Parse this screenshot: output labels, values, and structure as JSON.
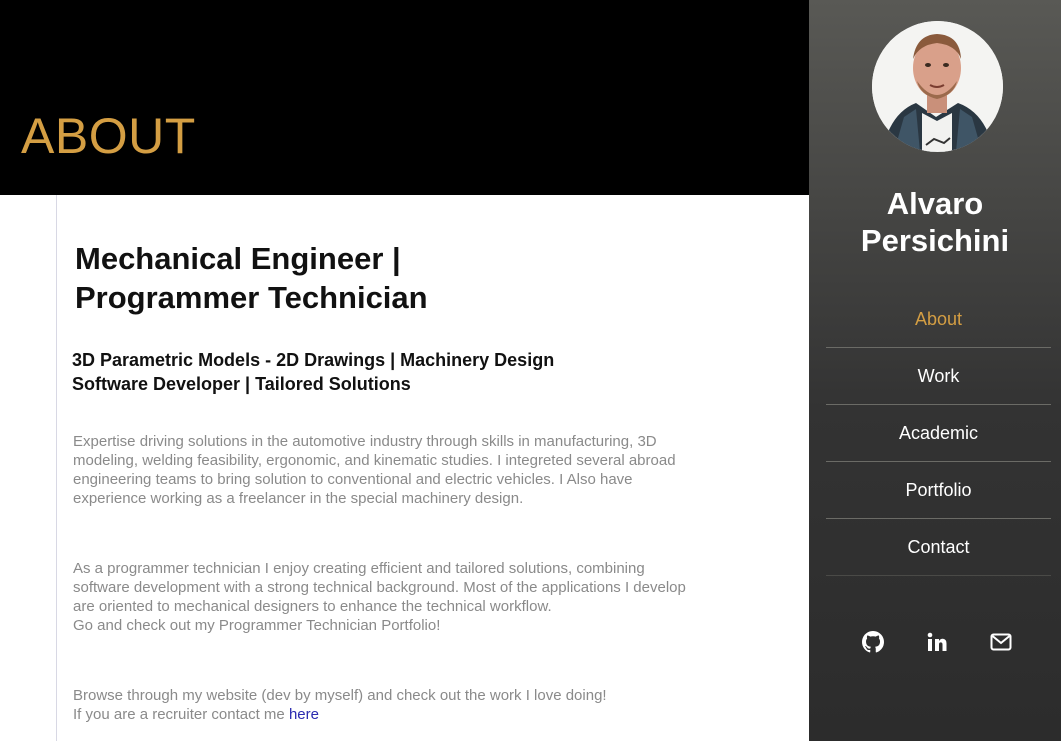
{
  "hero": {
    "title": "ABOUT"
  },
  "main": {
    "headline_line1": "Mechanical Engineer |",
    "headline_line2": "Programmer Technician",
    "subline_line1": "3D Parametric Models - 2D Drawings | Machinery Design",
    "subline_line2": "Software Developer | Tailored Solutions",
    "paragraph1": "Expertise driving solutions in the automotive industry through skills in manufacturing, 3D modeling, welding feasibility, ergonomic, and kinematic studies. I integreted several abroad engineering teams to bring solution to conventional and electric vehicles. I Also have experience working as a freelancer in the special machinery design.",
    "paragraph2_line1": "As a programmer technician I enjoy creating efficient and tailored solutions, combining software development with a strong technical background. Most of the applications I develop are oriented to mechanical designers to enhance the technical workflow.",
    "paragraph2_line2": "Go and check out my Programmer Technician Portfolio!",
    "paragraph3_line1": "Browse through my website (dev by myself) and check out the work I love doing!",
    "paragraph3_prefix": "If you are a recruiter contact me ",
    "paragraph3_link": "here"
  },
  "sidebar": {
    "name_line1": "Alvaro",
    "name_line2": "Persichini",
    "nav": [
      {
        "label": "About",
        "active": true
      },
      {
        "label": "Work"
      },
      {
        "label": "Academic"
      },
      {
        "label": "Portfolio"
      },
      {
        "label": "Contact"
      }
    ],
    "social": [
      "github-icon",
      "linkedin-icon",
      "mail-icon"
    ]
  },
  "colors": {
    "accent": "#d49e43",
    "hero_bg": "#000000",
    "sidebar_top": "#595955",
    "sidebar_bottom": "#2c2c2c",
    "body_text": "#8a8a8a",
    "link": "#2a2ab0"
  }
}
